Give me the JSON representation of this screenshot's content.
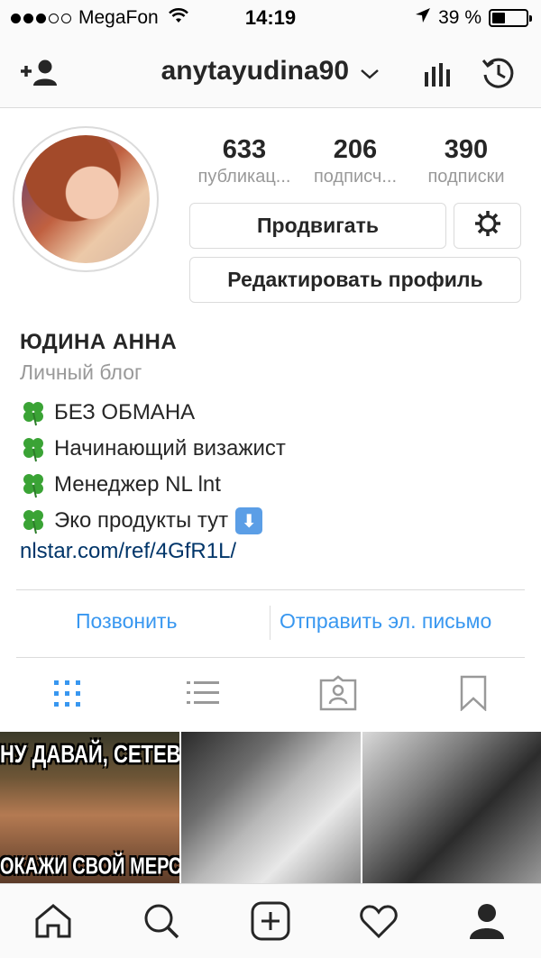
{
  "status_bar": {
    "carrier": "MegaFon",
    "time": "14:19",
    "battery_text": "39 %",
    "battery_level": 0.39
  },
  "header": {
    "username": "anytayudina90",
    "icons": [
      "add-user-icon",
      "chevron-down-icon",
      "stats-icon",
      "archive-icon"
    ]
  },
  "profile": {
    "stats": [
      {
        "value": "633",
        "label": "публикац..."
      },
      {
        "value": "206",
        "label": "подписч..."
      },
      {
        "value": "390",
        "label": "подписки"
      }
    ],
    "promote_label": "Продвигать",
    "edit_label": "Редактировать профиль"
  },
  "bio": {
    "name": "ЮДИНА АННА",
    "category": "Личный блог",
    "lines": [
      "БЕЗ ОБМАНА",
      "Начинающий визажист",
      "Менеджер NL lnt",
      "Эко продукты тут"
    ],
    "link": "nlstar.com/ref/4GfR1L/"
  },
  "contacts": {
    "call_label": "Позвонить",
    "email_label": "Отправить эл. письмо"
  },
  "grid": {
    "post1_top_text": "НУ ДАВАЙ, СЕТЕВИК",
    "post1_bottom_text": "ОКАЖИ СВОЙ МЕРСЕДЕ"
  },
  "colors": {
    "accent": "#3897f0",
    "link": "#003569",
    "text": "#262626",
    "muted": "#999999",
    "border": "#dbdbdb"
  }
}
